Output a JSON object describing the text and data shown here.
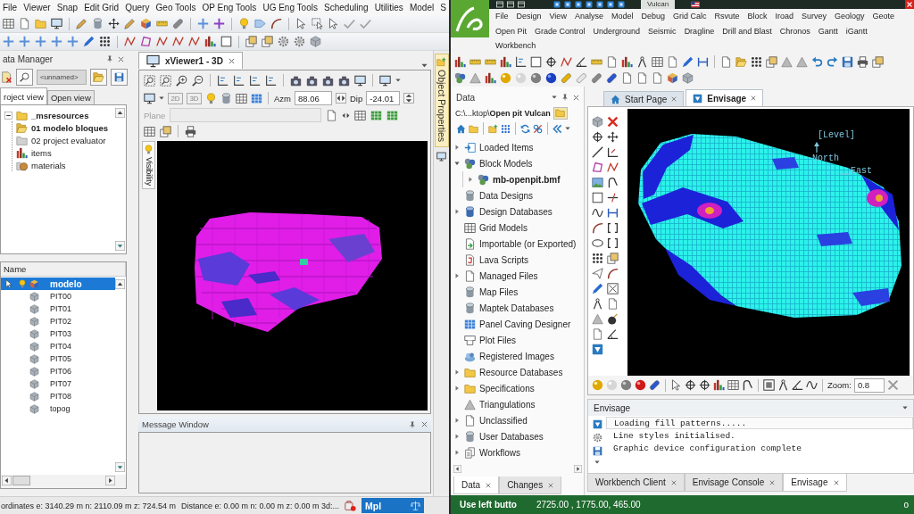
{
  "left_app": {
    "menu": [
      "File",
      "Viewer",
      "Snap",
      "Edit Grid",
      "Query",
      "Geo Tools",
      "OP Eng Tools",
      "UG Eng Tools",
      "Scheduling",
      "Utilities",
      "Model",
      "S"
    ],
    "data_manager": {
      "title": "ata Manager",
      "name_field": {
        "value": "<unnamed>"
      },
      "tabs": [
        {
          "label": "roject view",
          "selected": true
        },
        {
          "label": "Open view",
          "selected": false
        }
      ],
      "tree": [
        {
          "label": "_msresources",
          "kind": "folder",
          "bold": true,
          "expanded": true,
          "children": [
            {
              "label": "01 modelo bloques",
              "kind": "open-folder",
              "bold": true
            },
            {
              "label": "02 project evaluator",
              "kind": "plain-folder",
              "bold": false
            },
            {
              "label": "items",
              "kind": "chart",
              "bold": false
            },
            {
              "label": "materials",
              "kind": "material",
              "bold": false
            }
          ]
        }
      ],
      "list": {
        "columns": [
          "Name"
        ],
        "rows": [
          {
            "name": "modelo",
            "kind": "model",
            "active": true,
            "selected": true
          },
          {
            "name": "PIT00",
            "kind": "surface",
            "active": false,
            "selected": false
          },
          {
            "name": "PIT01",
            "kind": "surface",
            "active": false,
            "selected": false
          },
          {
            "name": "PIT02",
            "kind": "surface",
            "active": false,
            "selected": false
          },
          {
            "name": "PIT03",
            "kind": "surface",
            "active": false,
            "selected": false
          },
          {
            "name": "PIT04",
            "kind": "surface",
            "active": false,
            "selected": false
          },
          {
            "name": "PIT05",
            "kind": "surface",
            "active": false,
            "selected": false
          },
          {
            "name": "PIT06",
            "kind": "surface",
            "active": false,
            "selected": false
          },
          {
            "name": "PIT07",
            "kind": "surface",
            "active": false,
            "selected": false
          },
          {
            "name": "PIT08",
            "kind": "surface",
            "active": false,
            "selected": false
          },
          {
            "name": "topog",
            "kind": "surface",
            "active": false,
            "selected": false
          }
        ]
      }
    },
    "viewer": {
      "tab": {
        "label": "xViewer1 - 3D",
        "selected": true
      },
      "view_buttons": [
        "2D",
        "3D"
      ],
      "azm": {
        "label": "Azm",
        "value": "88.06"
      },
      "dip": {
        "label": "Dip",
        "value": "-24.01"
      },
      "plane": {
        "label": "Plane",
        "disabled": true
      },
      "side_tab": "Visibility"
    },
    "message_window": {
      "title": "Message Window"
    },
    "object_properties": {
      "label": "Object Properties"
    },
    "status_bar": {
      "coordinates": "ordinates e: 3140.29 m n: 2110.09 m z: 724.54 m",
      "distance": "Distance e: 0.00 m n: 0.00 m z: 0.00 m 3d:...",
      "mode": "Mpl"
    }
  },
  "right_app": {
    "title": "Vulcan",
    "menu": [
      [
        "File",
        "Design",
        "View",
        "Analyse",
        "Model",
        "Debug",
        "Grid Calc",
        "Rsvute",
        "Block",
        "Iroad",
        "Survey",
        "Geology",
        "Geote"
      ],
      [
        "Open Pit",
        "Grade Control",
        "Underground",
        "Seismic",
        "Dragline",
        "Drill and Blast",
        "Chronos",
        "Gantt",
        "iGantt"
      ],
      [
        "Workbench"
      ]
    ],
    "data_panel": {
      "title": "Data",
      "path": "C:\\...ktop\\**Open pit Vulcan**",
      "tree": [
        {
          "label": "Loaded Items",
          "kind": "loaded",
          "expanded": false,
          "bold": false
        },
        {
          "label": "Block Models",
          "kind": "blocks",
          "expanded": true,
          "bold": false,
          "children": [
            {
              "label": "mb-openpit.bmf",
              "kind": "blocks",
              "expanded": false,
              "bold": true
            }
          ]
        },
        {
          "label": "Data Designs",
          "kind": "database",
          "bold": false
        },
        {
          "label": "Design Databases",
          "kind": "design-database",
          "expanded": false,
          "bold": false
        },
        {
          "label": "Grid Models",
          "kind": "grid",
          "bold": false
        },
        {
          "label": "Importable (or Exported)",
          "kind": "import",
          "bold": false
        },
        {
          "label": "Lava Scripts",
          "kind": "script",
          "bold": false
        },
        {
          "label": "Managed Files",
          "kind": "file",
          "expanded": false,
          "bold": false
        },
        {
          "label": "Map Files",
          "kind": "database",
          "bold": false
        },
        {
          "label": "Maptek Databases",
          "kind": "database",
          "bold": false
        },
        {
          "label": "Panel Caving Designer",
          "kind": "blue-grid",
          "bold": false
        },
        {
          "label": "Plot Files",
          "kind": "plot",
          "bold": false
        },
        {
          "label": "Registered Images",
          "kind": "images",
          "bold": false
        },
        {
          "label": "Resource Databases",
          "kind": "folder",
          "expanded": false,
          "bold": false
        },
        {
          "label": "Specifications",
          "kind": "folder",
          "expanded": false,
          "bold": false
        },
        {
          "label": "Triangulations",
          "kind": "triangle",
          "bold": false
        },
        {
          "label": "Unclassified",
          "kind": "file",
          "expanded": false,
          "bold": false
        },
        {
          "label": "User Databases",
          "kind": "database",
          "expanded": false,
          "bold": false
        },
        {
          "label": "Workflows",
          "kind": "workflow",
          "expanded": false,
          "bold": false
        }
      ],
      "tabs": [
        {
          "label": "Data",
          "selected": true
        },
        {
          "label": "Changes",
          "selected": false
        }
      ]
    },
    "document_tabs": [
      {
        "label": "Start Page",
        "kind": "home",
        "selected": false
      },
      {
        "label": "Envisage",
        "kind": "view",
        "selected": true
      }
    ],
    "envisage": {
      "level_label": "[Level]",
      "north_label": "North",
      "east_label": "East",
      "zoom": {
        "label": "Zoom:",
        "value": "0.8"
      }
    },
    "console": {
      "title": "Envisage",
      "lines": [
        {
          "text": "Loading fill patterns.....",
          "selected": true
        },
        {
          "text": "Line styles initialised.",
          "selected": false
        },
        {
          "text": "Graphic device configuration complete",
          "selected": false
        }
      ]
    },
    "bottom_tabs": [
      {
        "label": "Workbench Client",
        "selected": false
      },
      {
        "label": "Envisage Console",
        "selected": false
      },
      {
        "label": "Envisage",
        "selected": true
      }
    ],
    "status_bar": {
      "prompt": "Use left butto",
      "coordinates": "2725.00 , 1775.00, 465.00",
      "right": "o"
    }
  }
}
